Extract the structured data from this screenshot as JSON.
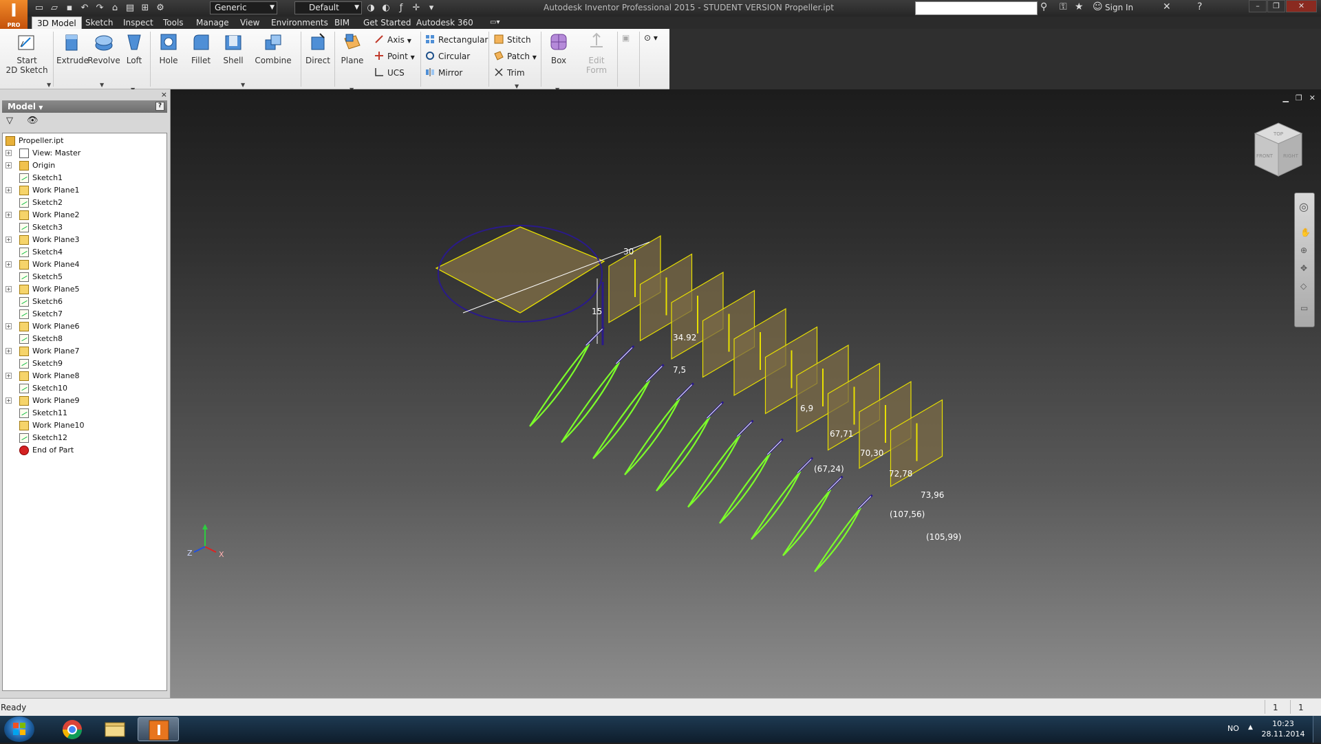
{
  "app": {
    "title": "Autodesk Inventor Professional 2015 - STUDENT VERSION   Propeller.ipt",
    "app_button_letter": "I",
    "app_button_badge": "PRO",
    "material_combo": "Generic",
    "appearance_combo": "Default",
    "sign_in": "Sign In"
  },
  "tabs": [
    "3D Model",
    "Sketch",
    "Inspect",
    "Tools",
    "Manage",
    "View",
    "Environments",
    "BIM",
    "Get Started",
    "Autodesk 360"
  ],
  "ribbon": {
    "start_sketch": "Start\n2D Sketch",
    "extrude": "Extrude",
    "revolve": "Revolve",
    "loft": "Loft",
    "hole": "Hole",
    "fillet": "Fillet",
    "shell": "Shell",
    "combine": "Combine",
    "direct": "Direct",
    "plane": "Plane",
    "axis": "Axis",
    "point": "Point",
    "ucs": "UCS",
    "rectangular": "Rectangular",
    "circular": "Circular",
    "mirror": "Mirror",
    "stitch": "Stitch",
    "patch": "Patch",
    "trim": "Trim",
    "box": "Box",
    "edit_form": "Edit\nForm"
  },
  "browser": {
    "header": "Model",
    "help": "?",
    "close": "×",
    "tree": [
      {
        "label": "Propeller.ipt",
        "icon": "part",
        "expand": false,
        "indent": 0
      },
      {
        "label": "View: Master",
        "icon": "view",
        "expand": true,
        "indent": 1
      },
      {
        "label": "Origin",
        "icon": "folder",
        "expand": true,
        "indent": 1
      },
      {
        "label": "Sketch1",
        "icon": "sketch",
        "expand": false,
        "indent": 1
      },
      {
        "label": "Work Plane1",
        "icon": "wp",
        "expand": true,
        "indent": 1
      },
      {
        "label": "Sketch2",
        "icon": "sketch",
        "expand": false,
        "indent": 1
      },
      {
        "label": "Work Plane2",
        "icon": "wp",
        "expand": true,
        "indent": 1
      },
      {
        "label": "Sketch3",
        "icon": "sketch",
        "expand": false,
        "indent": 1
      },
      {
        "label": "Work Plane3",
        "icon": "wp",
        "expand": true,
        "indent": 1
      },
      {
        "label": "Sketch4",
        "icon": "sketch",
        "expand": false,
        "indent": 1
      },
      {
        "label": "Work Plane4",
        "icon": "wp",
        "expand": true,
        "indent": 1
      },
      {
        "label": "Sketch5",
        "icon": "sketch",
        "expand": false,
        "indent": 1
      },
      {
        "label": "Work Plane5",
        "icon": "wp",
        "expand": true,
        "indent": 1
      },
      {
        "label": "Sketch6",
        "icon": "sketch",
        "expand": false,
        "indent": 1
      },
      {
        "label": "Sketch7",
        "icon": "sketch",
        "expand": false,
        "indent": 1
      },
      {
        "label": "Work Plane6",
        "icon": "wp",
        "expand": true,
        "indent": 1
      },
      {
        "label": "Sketch8",
        "icon": "sketch",
        "expand": false,
        "indent": 1
      },
      {
        "label": "Work Plane7",
        "icon": "wp",
        "expand": true,
        "indent": 1
      },
      {
        "label": "Sketch9",
        "icon": "sketch",
        "expand": false,
        "indent": 1
      },
      {
        "label": "Work Plane8",
        "icon": "wp",
        "expand": true,
        "indent": 1
      },
      {
        "label": "Sketch10",
        "icon": "sketch",
        "expand": false,
        "indent": 1
      },
      {
        "label": "Work Plane9",
        "icon": "wp",
        "expand": true,
        "indent": 1
      },
      {
        "label": "Sketch11",
        "icon": "sketch",
        "expand": false,
        "indent": 1
      },
      {
        "label": "Work Plane10",
        "icon": "wp",
        "expand": false,
        "indent": 1
      },
      {
        "label": "Sketch12",
        "icon": "sketch",
        "expand": false,
        "indent": 1
      },
      {
        "label": "End of Part",
        "icon": "end",
        "expand": false,
        "indent": 1
      }
    ]
  },
  "viewport": {
    "dimensions": [
      "30",
      "15",
      "34.92",
      "(67,24)",
      "(107,56)",
      "(105,99)",
      "7,5",
      "6,9",
      "67,71",
      "70,30",
      "72,78",
      "73,96"
    ],
    "viewcube_faces": [
      "TOP",
      "FRONT",
      "RIGHT"
    ],
    "axes": [
      "Z",
      "X"
    ]
  },
  "status": {
    "text": "Ready",
    "num1": "1",
    "num2": "1"
  },
  "taskbar": {
    "lang": "NO",
    "time": "10:23",
    "date": "28.11.2014"
  },
  "colors": {
    "sketch_green": "#7cff2a",
    "plane_yellow": "#e8e000",
    "plane_fill": "#7a6a45",
    "circle_purple": "#2a1a8a"
  }
}
